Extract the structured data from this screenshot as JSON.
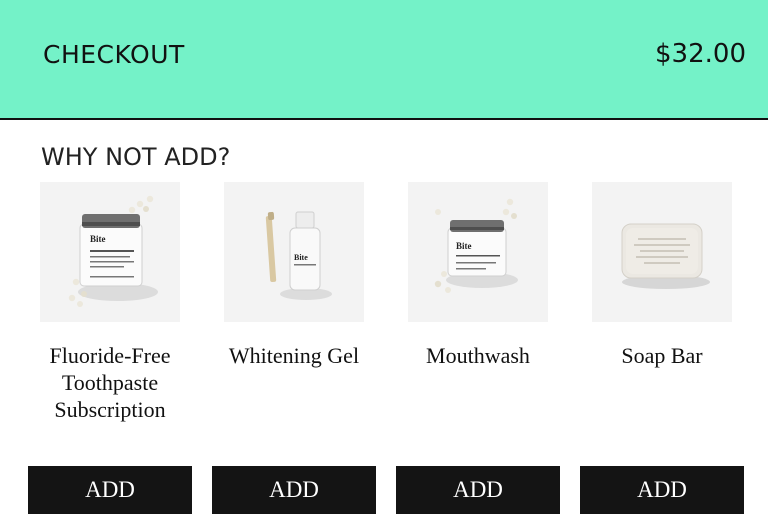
{
  "checkout": {
    "title": "CHECKOUT",
    "total": "$32.00"
  },
  "upsell": {
    "heading": "WHY NOT ADD?",
    "products": [
      {
        "name": "Fluoride-Free Toothpaste Subscription",
        "image_icon": "toothpaste-jar-icon",
        "jar_label": "Bite",
        "button_label": "ADD"
      },
      {
        "name": "Whitening Gel",
        "image_icon": "whitening-gel-bottle-icon",
        "jar_label": "Bite",
        "button_label": "ADD"
      },
      {
        "name": "Mouthwash",
        "image_icon": "mouthwash-jar-icon",
        "jar_label": "Bite",
        "button_label": "ADD"
      },
      {
        "name": "Soap Bar",
        "image_icon": "soap-bar-icon",
        "button_label": "ADD"
      }
    ]
  },
  "colors": {
    "header_bg": "#74f2c8",
    "button_bg": "#141414",
    "button_text": "#ffffff"
  }
}
